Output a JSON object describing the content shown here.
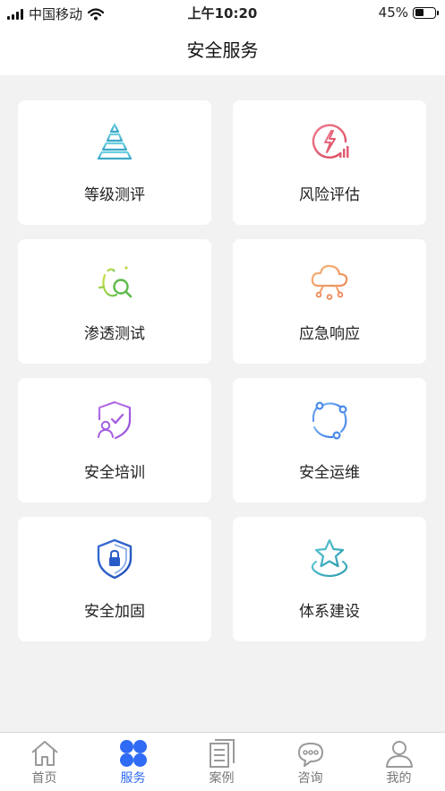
{
  "status_bar": {
    "carrier": "中国移动",
    "time": "上午10:20",
    "battery": "45%"
  },
  "header": {
    "title": "安全服务"
  },
  "services": [
    {
      "label": "等级测评",
      "icon": "pyramid-icon"
    },
    {
      "label": "风险评估",
      "icon": "risk-chart-icon"
    },
    {
      "label": "渗透测试",
      "icon": "bug-search-icon"
    },
    {
      "label": "应急响应",
      "icon": "cloud-network-icon"
    },
    {
      "label": "安全培训",
      "icon": "shield-user-icon"
    },
    {
      "label": "安全运维",
      "icon": "cycle-nodes-icon"
    },
    {
      "label": "安全加固",
      "icon": "shield-lock-icon"
    },
    {
      "label": "体系建设",
      "icon": "star-platform-icon"
    }
  ],
  "tabbar": [
    {
      "label": "首页",
      "icon": "home-icon",
      "active": false
    },
    {
      "label": "服务",
      "icon": "grid-icon",
      "active": true
    },
    {
      "label": "案例",
      "icon": "cases-icon",
      "active": false
    },
    {
      "label": "咨询",
      "icon": "chat-icon",
      "active": false
    },
    {
      "label": "我的",
      "icon": "user-icon",
      "active": false
    }
  ],
  "colors": {
    "active_tab": "#2f6bf5",
    "inactive_tab": "#777777",
    "background": "#f2f2f2"
  }
}
